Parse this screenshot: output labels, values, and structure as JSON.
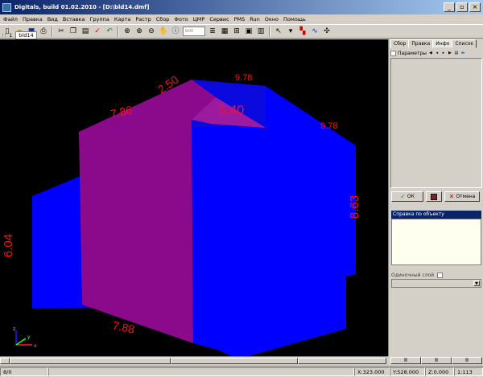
{
  "window": {
    "title": "Digitals, build 01.02.2010 - [D:\\bld14.dmf]"
  },
  "menu": [
    "Файл",
    "Правка",
    "Вид",
    "Вставка",
    "Группа",
    "Карта",
    "Растр",
    "Сбор",
    "Фото",
    "ЦМР",
    "Сервис",
    "PMS",
    "Run",
    "Окно",
    "Помощь"
  ],
  "toolbar": {
    "scale_value": "500"
  },
  "document": {
    "layer_number": "1",
    "tab_label": "bld14"
  },
  "view3d": {
    "colors": {
      "background": "#000000",
      "wall": "#0000ff",
      "roof": "#8b0a8c",
      "label": "#ff1010"
    },
    "dimensions": [
      "2.50",
      "9.78",
      "7.86",
      "5.40",
      "9.78",
      "8.63",
      "6.04",
      "7.88"
    ],
    "axes": {
      "x": "x",
      "y": "y",
      "z": "z"
    }
  },
  "panel": {
    "tabs": [
      "Сбор",
      "Правка",
      "Инфо",
      "Список"
    ],
    "active_tab": "Инфо",
    "parameters_label": "Параметры",
    "ok_label": "ОК",
    "cancel_label": "Отмена",
    "help_label": "Справка по объекту",
    "single_layer_label": "Одиночный слой"
  },
  "status": {
    "count": "8/0",
    "x": "X:323.000",
    "y": "Y:528.000",
    "z": "Z:0.000",
    "scale": "1:113"
  }
}
